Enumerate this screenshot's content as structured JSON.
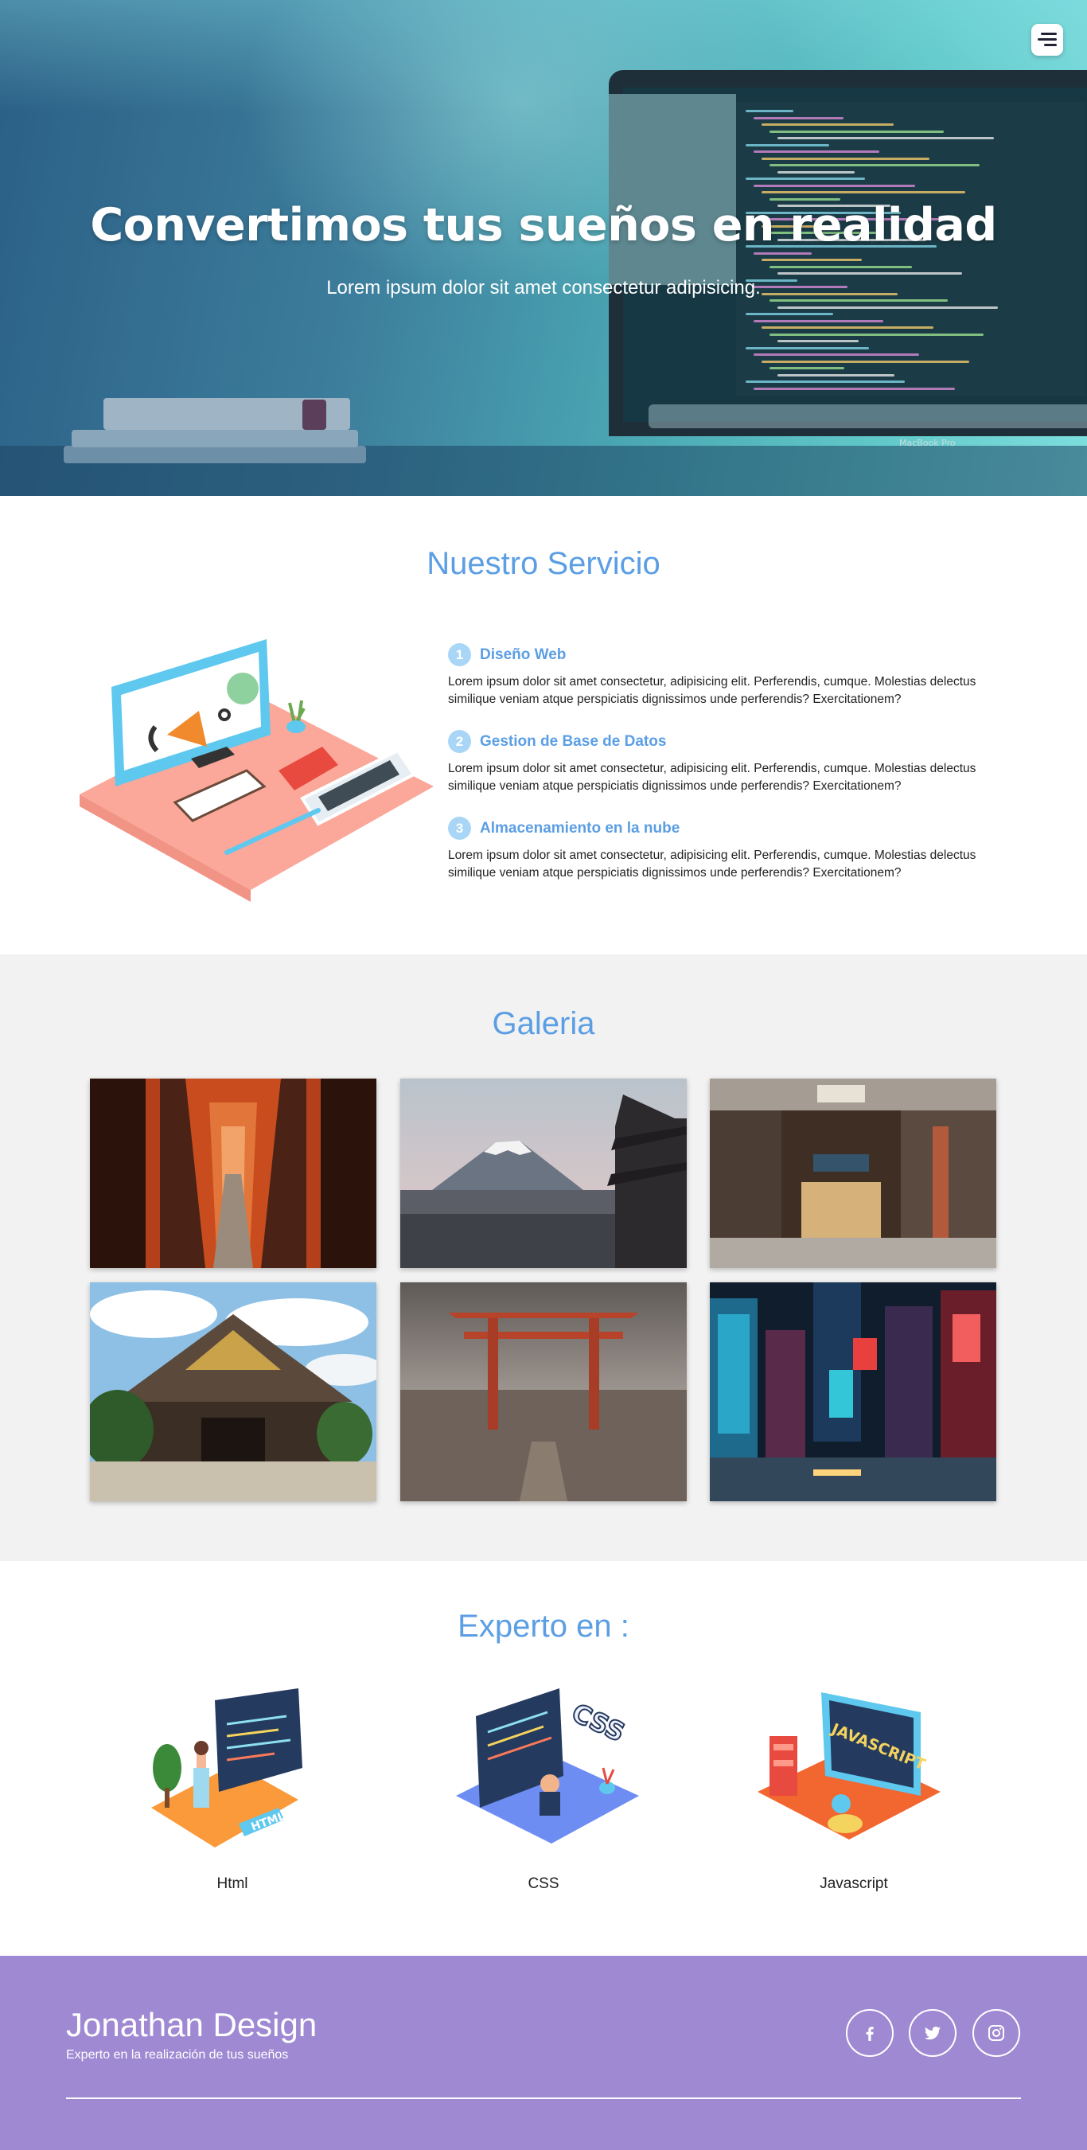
{
  "hero": {
    "title": "Convertimos tus sueños en realidad",
    "subtitle": "Lorem ipsum dolor sit amet consectetur adipisicing.",
    "menu_icon": "menu-icon",
    "laptop_brand": "MacBook Pro"
  },
  "services": {
    "title": "Nuestro Servicio",
    "items": [
      {
        "number": "1",
        "name": "Diseño Web",
        "description": "Lorem ipsum dolor sit amet consectetur, adipisicing elit. Perferendis, cumque. Molestias delectus similique veniam atque perspiciatis dignissimos unde perferendis? Exercitationem?"
      },
      {
        "number": "2",
        "name": "Gestion de Base de Datos",
        "description": "Lorem ipsum dolor sit amet consectetur, adipisicing elit. Perferendis, cumque. Molestias delectus similique veniam atque perspiciatis dignissimos unde perferendis? Exercitationem?"
      },
      {
        "number": "3",
        "name": "Almacenamiento en la nube",
        "description": "Lorem ipsum dolor sit amet consectetur, adipisicing elit. Perferendis, cumque. Molestias delectus similique veniam atque perspiciatis dignissimos unde perferendis? Exercitationem?"
      }
    ]
  },
  "gallery": {
    "title": "Galeria"
  },
  "expert": {
    "title": "Experto en :",
    "skills": [
      {
        "label": "Html",
        "badge": "HTML"
      },
      {
        "label": "CSS",
        "badge": "CSS"
      },
      {
        "label": "Javascript",
        "badge": "JAVASCRIPT"
      }
    ]
  },
  "footer": {
    "brand": "Jonathan Design",
    "tagline": "Experto en la realización de tus sueños",
    "social": [
      "facebook-icon",
      "twitter-icon",
      "instagram-icon"
    ]
  },
  "colors": {
    "accent": "#5b9ee4",
    "footer_bg": "#9f89d2",
    "gallery_bg": "#f2f2f2"
  }
}
